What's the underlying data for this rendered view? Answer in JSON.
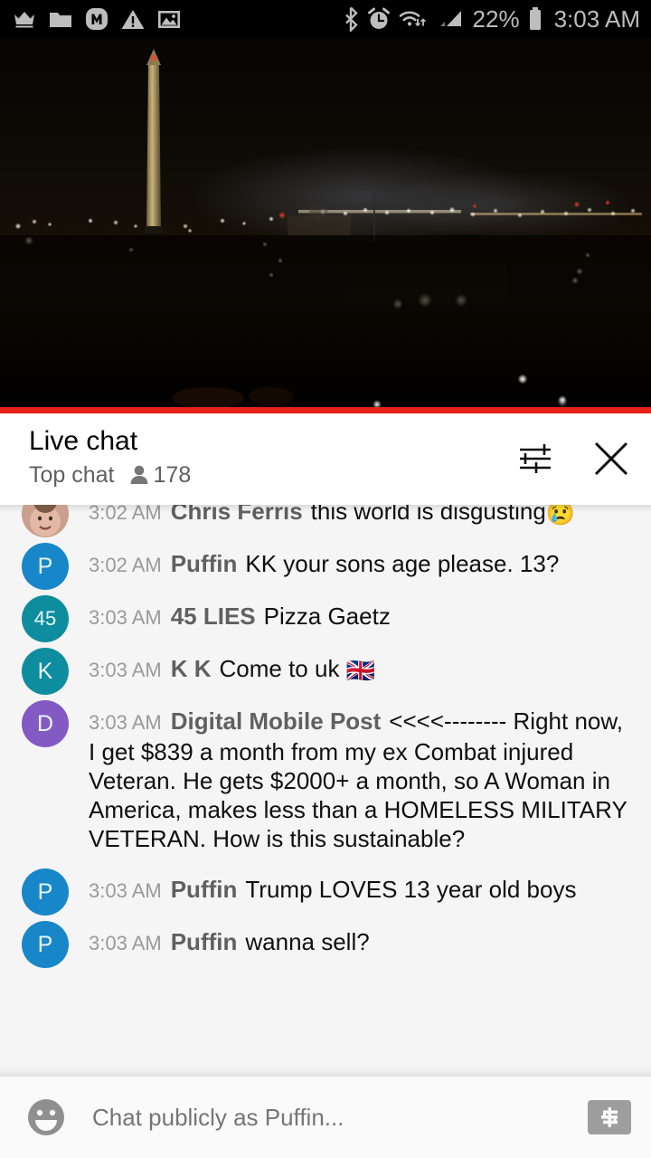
{
  "status_bar": {
    "left_icons": [
      "crown-icon",
      "folder-icon",
      "m-badge-icon",
      "warning-icon",
      "image-icon"
    ],
    "right_icons": [
      "bluetooth-icon",
      "alarm-icon",
      "wifi-icon",
      "signal-icon"
    ],
    "battery_percent": "22%",
    "battery_icon": "battery-icon",
    "clock": "3:03 AM",
    "text_color": "#bdbdbd",
    "background": "#000000"
  },
  "video": {
    "name": "live-stream-washington-monument-night",
    "progress_color": "#e52117",
    "progress_percent": 100
  },
  "chat_header": {
    "title": "Live chat",
    "mode": "Top chat",
    "viewer_icon": "person-icon",
    "viewers": "178",
    "settings_icon": "tune-icon",
    "close_icon": "close-icon"
  },
  "messages": [
    {
      "id": "msg-chris-ferris",
      "partial": true,
      "avatar_type": "photo",
      "avatar_initial": "",
      "avatar_color": "#caa79a",
      "timestamp": "3:02 AM",
      "author": "Chris Ferris",
      "text": "this world is disgusting",
      "emoji": "😢"
    },
    {
      "id": "msg-puffin-1",
      "partial": false,
      "avatar_type": "initial",
      "avatar_initial": "P",
      "avatar_color": "#1787c9",
      "timestamp": "3:02 AM",
      "author": "Puffin",
      "text": "KK your sons age please. 13?",
      "emoji": ""
    },
    {
      "id": "msg-45-lies",
      "partial": false,
      "avatar_type": "initial",
      "avatar_initial": "45",
      "avatar_color": "#0e8d9e",
      "timestamp": "3:03 AM",
      "author": "45 LIES",
      "text": "Pizza Gaetz",
      "emoji": ""
    },
    {
      "id": "msg-kk",
      "partial": false,
      "avatar_type": "initial",
      "avatar_initial": "K",
      "avatar_color": "#0e8d9e",
      "timestamp": "3:03 AM",
      "author": "K K",
      "text": "Come to uk ",
      "emoji": "🇬🇧"
    },
    {
      "id": "msg-digital-mobile-post",
      "partial": false,
      "avatar_type": "initial",
      "avatar_initial": "D",
      "avatar_color": "#8košek"
    },
    {
      "id": "msg-puffin-2",
      "partial": false,
      "avatar_type": "initial",
      "avatar_initial": "P",
      "avatar_color": "#1787c9",
      "timestamp": "3:03 AM",
      "author": "Puffin",
      "text": "Trump LOVES 13 year old boys",
      "emoji": ""
    },
    {
      "id": "msg-puffin-3",
      "partial": false,
      "avatar_type": "initial",
      "avatar_initial": "P",
      "avatar_color": "#1787c9",
      "timestamp": "3:03 AM",
      "author": "Puffin",
      "text": "wanna sell?",
      "emoji": ""
    }
  ],
  "long_message": {
    "id": "msg-digital-mobile-post",
    "avatar_initial": "D",
    "avatar_color": "#8359c4",
    "timestamp": "3:03 AM",
    "author": "Digital Mobile Post",
    "text": "<<<<-------- Right now, I get $839 a month from my ex Combat injured Veteran. He gets $2000+ a month, so A Woman in America, makes less than a HOMELESS MILITARY VETERAN. How is this sustainable?"
  },
  "composer": {
    "emoji_icon": "emoji-smile-icon",
    "placeholder": "Chat publicly as Puffin...",
    "value": "",
    "superchat_icon": "dollar-bill-icon"
  }
}
